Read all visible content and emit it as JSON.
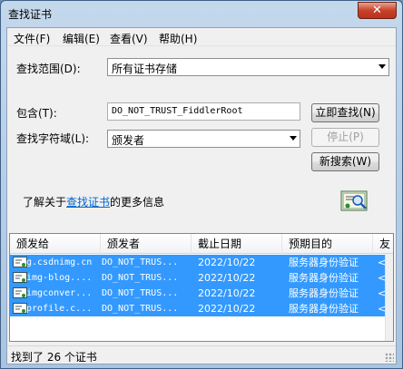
{
  "window": {
    "title": "查找证书",
    "close_label": "✕"
  },
  "menu": {
    "items": [
      "文件(F)",
      "编辑(E)",
      "查看(V)",
      "帮助(H)"
    ]
  },
  "form": {
    "scope_label": "查找范围(D):",
    "scope_value": "所有证书存储",
    "contains_label": "包含(T):",
    "contains_value": "DO_NOT_TRUST_FiddlerRoot",
    "field_label": "查找字符域(L):",
    "field_value": "颁发者",
    "find_now": "立即查找(N)",
    "stop": "停止(P)",
    "new_search": "新搜索(W)",
    "info_prefix": "了解关于",
    "info_link": "查找证书",
    "info_suffix": "的更多信息"
  },
  "list": {
    "columns": [
      "颁发给",
      "颁发者",
      "截止日期",
      "预期目的",
      "友"
    ],
    "rows": [
      {
        "issued_to": "g.csdnimg.cn",
        "issuer": "DO_NOT_TRUS...",
        "expires": "2022/10/22",
        "purpose": "服务器身份验证"
      },
      {
        "issued_to": "img-blog....",
        "issuer": "DO_NOT_TRUS...",
        "expires": "2022/10/22",
        "purpose": "服务器身份验证"
      },
      {
        "issued_to": "imgconver...",
        "issuer": "DO_NOT_TRUS...",
        "expires": "2022/10/22",
        "purpose": "服务器身份验证"
      },
      {
        "issued_to": "profile.c...",
        "issuer": "DO_NOT_TRUS...",
        "expires": "2022/10/22",
        "purpose": "服务器身份验证"
      }
    ],
    "row_tail": "<"
  },
  "status": {
    "text": "找到了 26 个证书"
  }
}
